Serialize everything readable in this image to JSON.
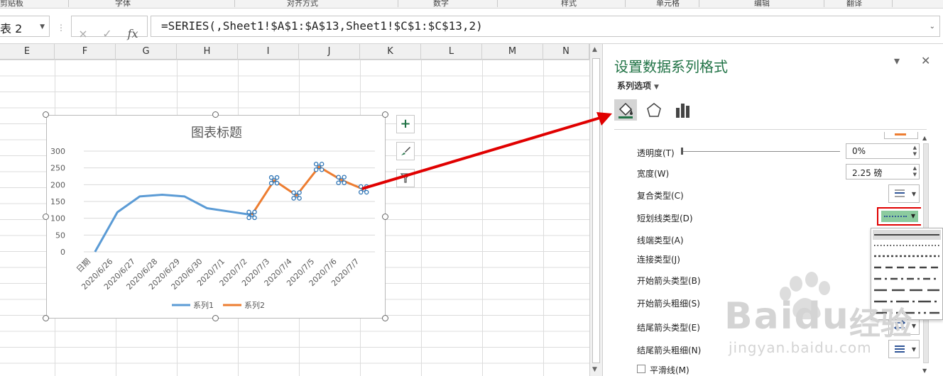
{
  "ribbon": {
    "groups": [
      {
        "label": "剪贴板"
      },
      {
        "label": "字体"
      },
      {
        "label": "对齐方式"
      },
      {
        "label": "数字"
      },
      {
        "label": "样式"
      },
      {
        "label": "单元格"
      },
      {
        "label": "编辑"
      },
      {
        "label": "翻译"
      }
    ]
  },
  "formula_bar": {
    "name_box": "表 2",
    "cancel_icon": "×",
    "enter_icon": "✓",
    "fx_icon": "fx",
    "formula": "=SERIES(,Sheet1!$A$1:$A$13,Sheet1!$C$1:$C$13,2)"
  },
  "columns": [
    "E",
    "F",
    "G",
    "H",
    "I",
    "J",
    "K",
    "L",
    "M",
    "N"
  ],
  "chart_data": {
    "type": "line",
    "title": "图表标题",
    "categories": [
      "日期",
      "2020/6/26",
      "2020/6/27",
      "2020/6/28",
      "2020/6/29",
      "2020/6/30",
      "2020/7/1",
      "2020/7/2",
      "2020/7/3",
      "2020/7/4",
      "2020/7/5",
      "2020/7/6",
      "2020/7/7"
    ],
    "series": [
      {
        "name": "系列1",
        "color": "#5B9BD5",
        "values": [
          0,
          118,
          165,
          170,
          165,
          130,
          120,
          110,
          null,
          null,
          null,
          null,
          null
        ]
      },
      {
        "name": "系列2",
        "color": "#ED7D31",
        "values": [
          null,
          null,
          null,
          null,
          null,
          null,
          null,
          110,
          213,
          168,
          253,
          214,
          186
        ]
      }
    ],
    "ylim": [
      0,
      300
    ],
    "yticks": [
      "0",
      "50",
      "100",
      "150",
      "200",
      "250",
      "300"
    ],
    "grid": true,
    "legend": "bottom"
  },
  "chart_buttons": {
    "add": "+",
    "style": "brush-icon",
    "filter": "filter-icon"
  },
  "pane": {
    "title": "设置数据系列格式",
    "subtitle": "系列选项",
    "rows": {
      "transparency": {
        "label": "透明度(T)",
        "value": "0%"
      },
      "width": {
        "label": "宽度(W)",
        "value": "2.25 磅"
      },
      "compound": {
        "label": "复合类型(C)"
      },
      "dash": {
        "label": "短划线类型(D)"
      },
      "cap": {
        "label": "线端类型(A)"
      },
      "join": {
        "label": "连接类型(J)"
      },
      "begin_arrow_type": {
        "label": "开始箭头类型(B)"
      },
      "begin_arrow_size": {
        "label": "开始箭头粗细(S)"
      },
      "end_arrow_type": {
        "label": "结尾箭头类型(E)"
      },
      "end_arrow_size": {
        "label": "结尾箭头粗细(N)"
      },
      "smooth": {
        "label": "平滑线(M)"
      }
    }
  },
  "watermark": {
    "brand": "Baidu",
    "cn": "经验",
    "url": "jingyan.baidu.com"
  },
  "colors": {
    "accent": "#217346",
    "highlight": "#E00000",
    "series1": "#5B9BD5",
    "series2": "#ED7D31"
  }
}
